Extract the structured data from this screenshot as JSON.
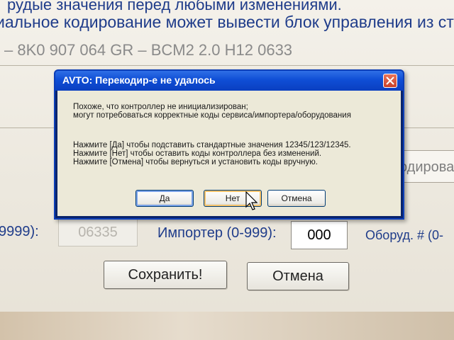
{
  "background": {
    "line1": "иальное кодирование может вывести блок управления из ст",
    "line0": "рудые значения перед любыми изменениями.",
    "line3": "– 8K0 907 064 GR – BCM2 2.0      H12 0633",
    "right_field_text": "кодирова",
    "service_label": "9999):",
    "service_value": "06335",
    "importer_label": "Импортер (0-999):",
    "importer_value": "000",
    "equipment_label": "Оборуд. # (0-",
    "save_button": "Сохранить!",
    "cancel_button": "Отмена"
  },
  "dialog": {
    "title": "AVTO: Перекодир-е не удалось",
    "message_lines": [
      "Похоже, что контроллер не инициализирован;",
      "могут потребоваться корректные коды сервиса/импортера/оборудования",
      "Нажмите [Да] чтобы подставить стандартные значения 12345/123/12345.",
      "Нажмите [Нет] чтобы оставить коды контроллера без изменений.",
      "Нажмите [Отмена] чтобы вернуться и установить коды вручную."
    ],
    "buttons": {
      "yes": "Да",
      "no": "Нет",
      "cancel": "Отмена"
    }
  },
  "colors": {
    "titlebar": "#0f4ed6",
    "label_text": "#1f3c8a",
    "close_button": "#c9422a"
  },
  "icons": {
    "close": "close-icon",
    "cursor": "mouse-cursor-icon"
  }
}
